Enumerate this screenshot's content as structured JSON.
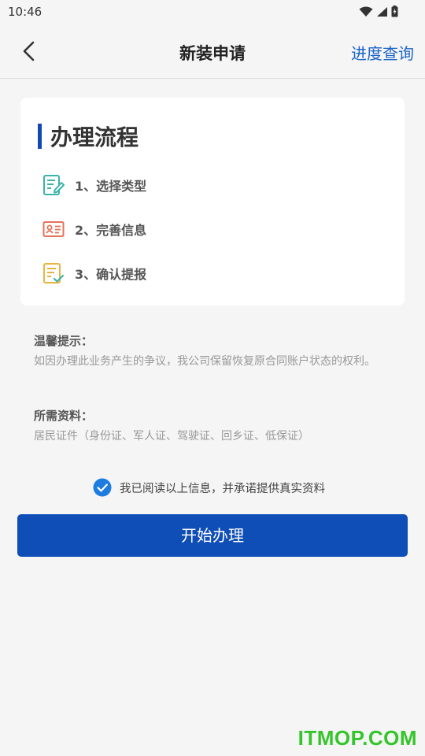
{
  "status_bar": {
    "time": "10:46"
  },
  "header": {
    "title": "新装申请",
    "action_link": "进度查询"
  },
  "process_card": {
    "title": "办理流程",
    "steps": [
      {
        "label": "1、选择类型",
        "icon": "edit-form-icon"
      },
      {
        "label": "2、完善信息",
        "icon": "id-card-icon"
      },
      {
        "label": "3、确认提报",
        "icon": "document-check-icon"
      }
    ]
  },
  "tips": {
    "notice_title": "温馨提示：",
    "notice_text": "如因办理此业务产生的争议，我公司保留恢复原合同账户状态的权利。",
    "materials_title": "所需资料：",
    "materials_text": "居民证件（身份证、军人证、驾驶证、回乡证、低保证）"
  },
  "agreement": {
    "checked": true,
    "text": "我已阅读以上信息，并承诺提供真实资料"
  },
  "start_button": {
    "label": "开始办理"
  },
  "watermark": {
    "text": "ITMOP.COM"
  },
  "colors": {
    "primary": "#0f4db7",
    "link": "#1a63c6",
    "checkbox": "#1e7be0",
    "watermark": "#34c52a"
  }
}
